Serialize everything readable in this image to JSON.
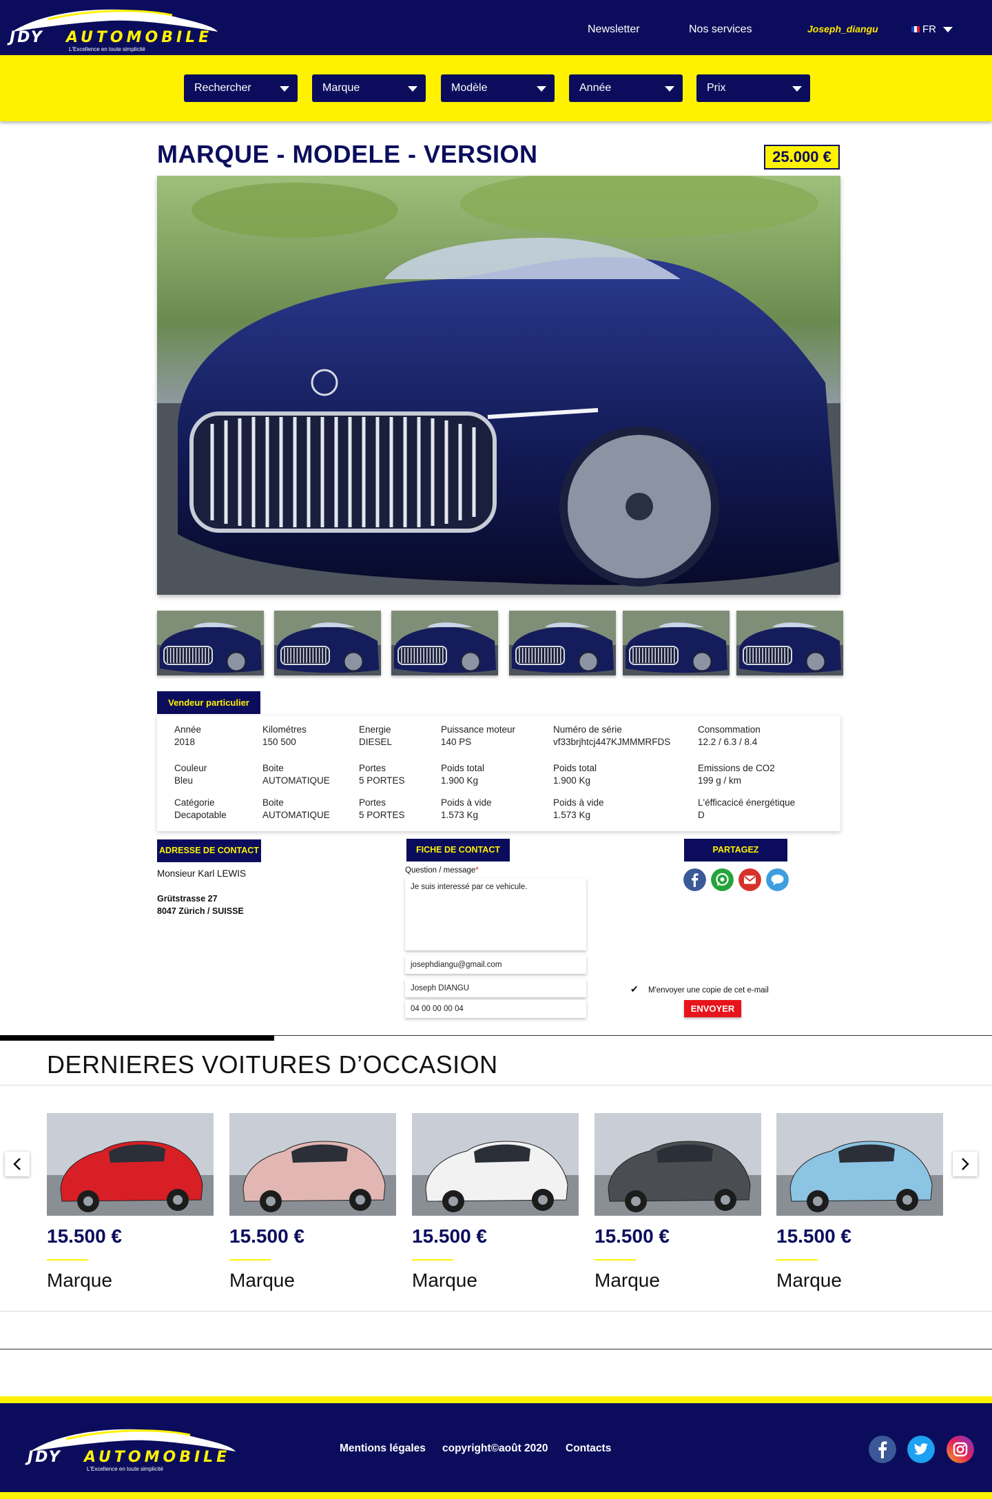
{
  "brand": {
    "name_left": "JDY",
    "name_right": "AUTOMOBILE",
    "tagline": "L'Excellence en toute simplicité",
    "colors": {
      "primary": "#0b0d5c",
      "accent": "#fff200",
      "danger": "#e8141b"
    }
  },
  "header": {
    "nav": [
      "Newsletter",
      "Nos services"
    ],
    "user": "Joseph_diangu",
    "language": "FR",
    "language_icon": "flag-fr-icon"
  },
  "search": {
    "filters": [
      "Rechercher",
      "Marque",
      "Modèle",
      "Année",
      "Prix"
    ]
  },
  "listing": {
    "title": "MARQUE - MODELE - VERSION",
    "price": "25.000 €",
    "seller_type": "Vendeur particulier",
    "specs": [
      {
        "label": "Année",
        "value": "2018"
      },
      {
        "label": "Kilométres",
        "value": "150 500"
      },
      {
        "label": "Energie",
        "value": "DIESEL"
      },
      {
        "label": "Puissance moteur",
        "value": "140 PS"
      },
      {
        "label": "Numéro de série",
        "value": "vf33brjhtcj447KJMMMRFDS"
      },
      {
        "label": "Consommation",
        "value": "12.2 / 6.3 / 8.4"
      },
      {
        "label": "Couleur",
        "value": "Bleu"
      },
      {
        "label": "Boite",
        "value": "AUTOMATIQUE"
      },
      {
        "label": "Portes",
        "value": "5 PORTES"
      },
      {
        "label": "Poids total",
        "value": "1.900 Kg"
      },
      {
        "label": "Poids total",
        "value": "1.900 Kg"
      },
      {
        "label": "Emissions de CO2",
        "value": "199 g / km"
      },
      {
        "label": "Catégorie",
        "value": "Decapotable"
      },
      {
        "label": "Boite",
        "value": "AUTOMATIQUE"
      },
      {
        "label": "Portes",
        "value": "5 PORTES"
      },
      {
        "label": "Poids à vide",
        "value": "1.573 Kg"
      },
      {
        "label": "Poids à vide",
        "value": "1.573 Kg"
      },
      {
        "label": "L'éfficacicé énergétique",
        "value": "D"
      }
    ]
  },
  "contact_address": {
    "heading": "ADRESSE DE CONTACT",
    "name": "Monsieur Karl LEWIS",
    "street": "Grütstrasse 27",
    "city": "8047 Zürich / SUISSE"
  },
  "contact_form": {
    "heading": "FICHE DE CONTACT",
    "message_label": "Question / message",
    "required_mark": "*",
    "message": "Je suis interessé par ce vehicule.",
    "email": "josephdiangu@gmail.com",
    "name": "Joseph DIANGU",
    "phone": "04 00 00 00 04",
    "copy_label": "M'envoyer une copie de cet e-mail",
    "copy_checked": true,
    "submit": "ENVOYER"
  },
  "share": {
    "heading": "PARTAGEZ",
    "icons": [
      "facebook-icon",
      "whatsapp-icon",
      "gmail-icon",
      "sms-icon"
    ]
  },
  "recent": {
    "heading": "DERNIERES VOITURES  D’OCCASION",
    "cards": [
      {
        "price": "15.500 €",
        "brand": "Marque",
        "color": "#d81f26"
      },
      {
        "price": "15.500 €",
        "brand": "Marque",
        "color": "#e2b7b3"
      },
      {
        "price": "15.500 €",
        "brand": "Marque",
        "color": "#f2f2f2"
      },
      {
        "price": "15.500 €",
        "brand": "Marque",
        "color": "#4a4e52"
      },
      {
        "price": "15.500 €",
        "brand": "Marque",
        "color": "#8cc4e4"
      }
    ]
  },
  "footer": {
    "links": [
      "Mentions légales",
      "copyright©août 2020",
      "Contacts"
    ],
    "social": [
      "facebook-icon",
      "twitter-icon",
      "instagram-icon"
    ]
  }
}
